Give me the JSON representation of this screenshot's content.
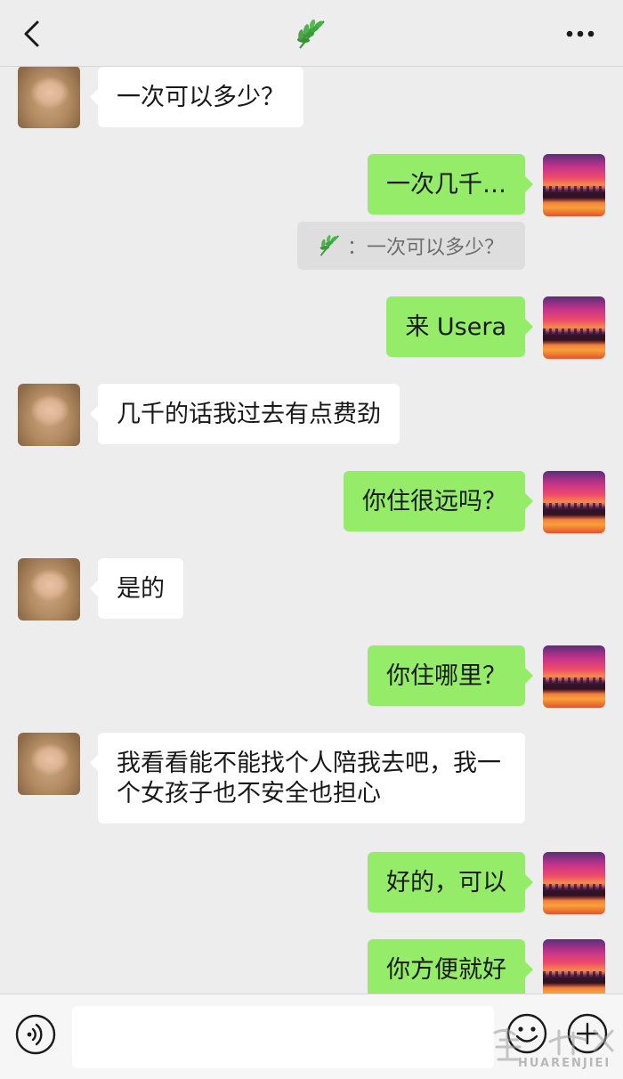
{
  "header": {
    "back_icon": "chevron-left-icon",
    "title_icon": "leaf-icon",
    "more_icon": "ellipsis-icon"
  },
  "messages": [
    {
      "side": "left",
      "text": "一次可以多少？"
    },
    {
      "side": "right",
      "text": "一次几千…"
    },
    {
      "side": "quote",
      "text": "：一次可以多少？"
    },
    {
      "side": "right",
      "text": "来 Usera"
    },
    {
      "side": "left",
      "text": "几千的话我过去有点费劲"
    },
    {
      "side": "right",
      "text": "你住很远吗？"
    },
    {
      "side": "left",
      "text": "是的"
    },
    {
      "side": "right",
      "text": "你住哪里？"
    },
    {
      "side": "left",
      "text": "我看看能不能找个人陪我去吧，我一个女孩子也不安全也担心"
    },
    {
      "side": "right",
      "text": "好的，可以"
    },
    {
      "side": "right",
      "text": "你方便就好"
    }
  ],
  "input_bar": {
    "voice_icon": "voice-icon",
    "input_value": "",
    "emoji_icon": "emoji-icon",
    "plus_icon": "plus-icon"
  },
  "watermark": {
    "text": "HUARENJIEI"
  },
  "colors": {
    "background": "#ededed",
    "sent_bubble": "#95ec69",
    "received_bubble": "#ffffff",
    "leaf_green": "#3a9a3a"
  }
}
